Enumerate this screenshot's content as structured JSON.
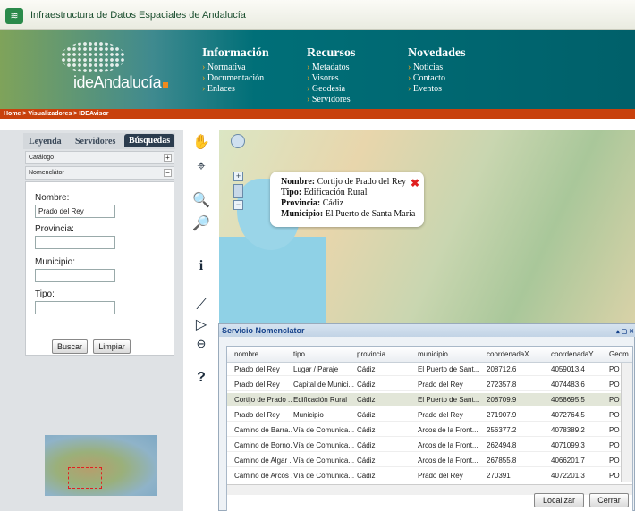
{
  "app_title": "Infraestructura de Datos Espaciales de Andalucía",
  "logo_text": "ideAndalucía",
  "menu": [
    {
      "heading": "Información",
      "items": [
        "Normativa",
        "Documentación",
        "Enlaces"
      ]
    },
    {
      "heading": "Recursos",
      "items": [
        "Metadatos",
        "Visores",
        "Geodesia",
        "Servidores"
      ]
    },
    {
      "heading": "Novedades",
      "items": [
        "Noticias",
        "Contacto",
        "Eventos"
      ]
    }
  ],
  "breadcrumb": "Home > Visualizadores > IDEAvisor",
  "tabs": [
    "Leyenda",
    "Servidores",
    "Búsquedas"
  ],
  "accordion": [
    "Catálogo",
    "Nomenclátor"
  ],
  "form": {
    "labels": [
      "Nombre:",
      "Provincia:",
      "Municipio:",
      "Tipo:"
    ],
    "nombre_value": "Prado del Rey",
    "buscar": "Buscar",
    "limpiar": "Limpiar"
  },
  "popup": {
    "nombre_label": "Nombre:",
    "nombre": "Cortijo de Prado del Rey",
    "tipo_label": "Tipo:",
    "tipo": "Edificación Rural",
    "provincia_label": "Provincia:",
    "provincia": "Cádiz",
    "municipio_label": "Municipio:",
    "municipio": "El Puerto de Santa Maria"
  },
  "panel": {
    "title": "Servicio Nomenclator",
    "columns": [
      "nombre",
      "tipo",
      "provincia",
      "municipio",
      "coordenadaX",
      "coordenadaY",
      "Geom"
    ],
    "rows": [
      [
        "Prado del Rey",
        "Lugar / Paraje",
        "Cádiz",
        "El Puerto de Sant...",
        "208712.6",
        "4059013.4",
        "PO"
      ],
      [
        "Prado del Rey",
        "Capital de Munici...",
        "Cádiz",
        "Prado del Rey",
        "272357.8",
        "4074483.6",
        "PO"
      ],
      [
        "Cortijo de Prado ...",
        "Edificación Rural",
        "Cádiz",
        "El Puerto de Sant...",
        "208709.9",
        "4058695.5",
        "PO"
      ],
      [
        "Prado del Rey",
        "Municipio",
        "Cádiz",
        "Prado del Rey",
        "271907.9",
        "4072764.5",
        "PO"
      ],
      [
        "Camino de Barra...",
        "Vía de Comunica...",
        "Cádiz",
        "Arcos de la Front...",
        "256377.2",
        "4078389.2",
        "PO"
      ],
      [
        "Camino de Borno...",
        "Vía de Comunica...",
        "Cádiz",
        "Arcos de la Front...",
        "262494.8",
        "4071099.3",
        "PO"
      ],
      [
        "Camino de Algar ...",
        "Vía de Comunica...",
        "Cádiz",
        "Arcos de la Front...",
        "267855.8",
        "4066201.7",
        "PO"
      ],
      [
        "Camino de Arcos ...",
        "Vía de Comunica...",
        "Cádiz",
        "Prado del Rey",
        "270391",
        "4072201.3",
        "PO"
      ]
    ],
    "localizar": "Localizar",
    "cerrar": "Cerrar"
  }
}
